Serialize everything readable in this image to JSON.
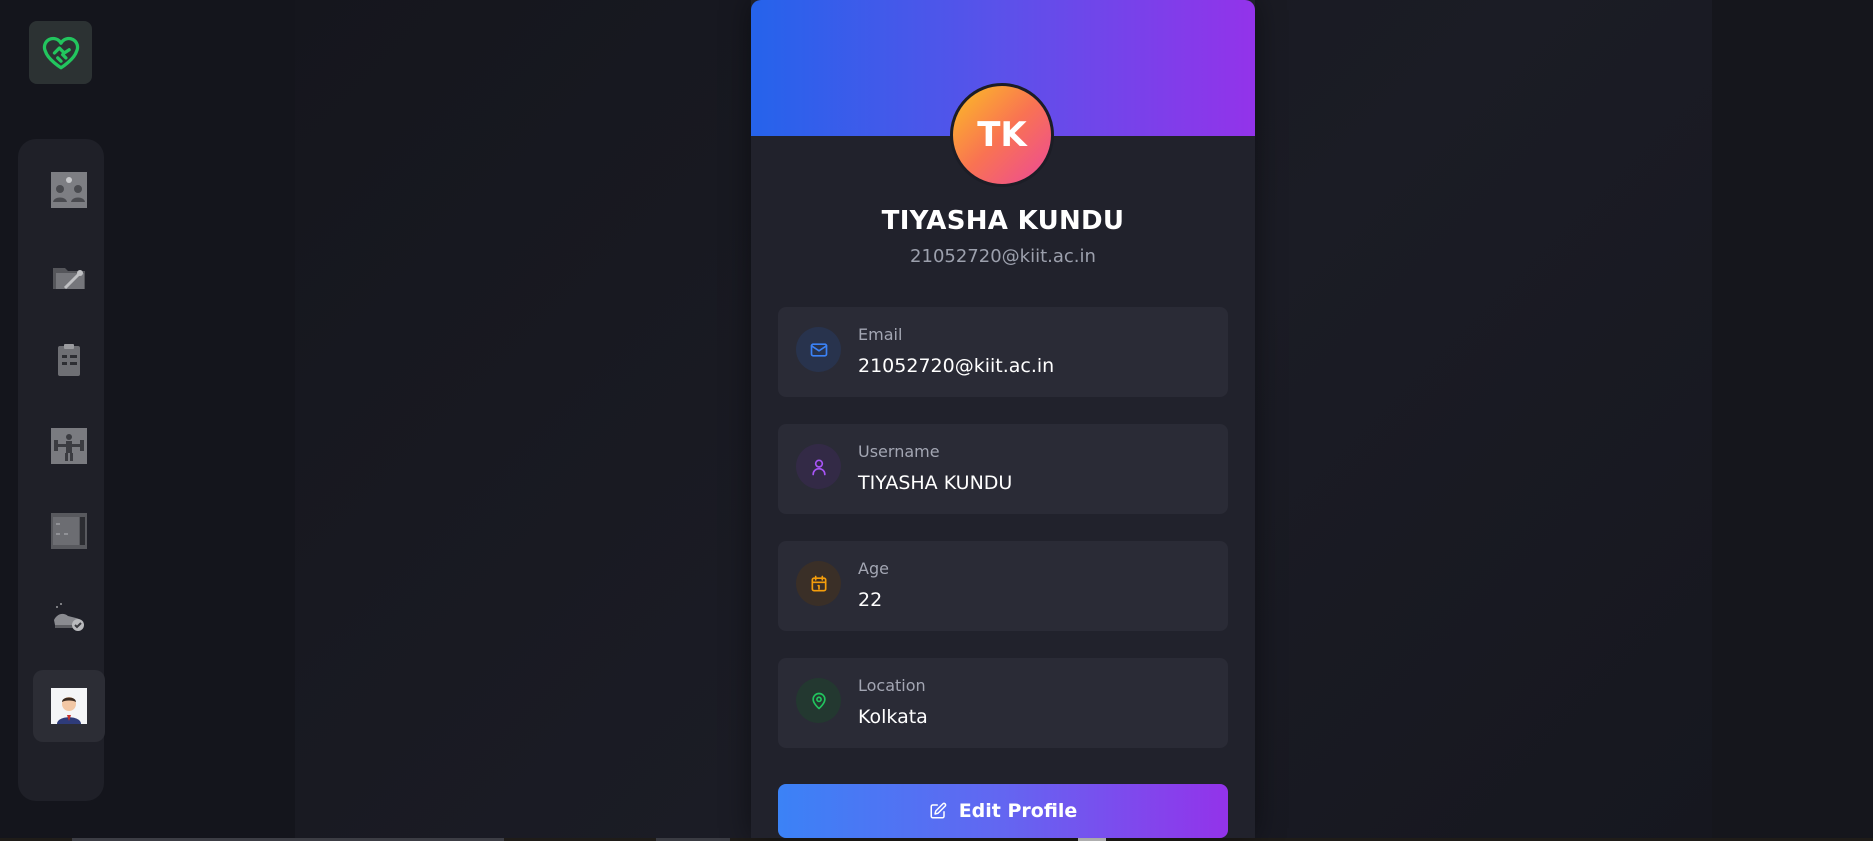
{
  "colors": {
    "header_gradient": [
      "#2563eb",
      "#9333ea"
    ],
    "avatar_gradient": [
      "#fbbf24",
      "#ec4899"
    ],
    "logo_green": "#22c55e",
    "email_accent": "#3b82f6",
    "username_accent": "#a855f7",
    "age_accent": "#f59e0b",
    "location_accent": "#22c55e"
  },
  "app": {
    "logo_icon": "heart-handshake-icon"
  },
  "sidebar": {
    "items": [
      {
        "icon": "group-meeting-icon",
        "active": false
      },
      {
        "icon": "folder-tools-icon",
        "active": false
      },
      {
        "icon": "clipboard-checklist-icon",
        "active": false
      },
      {
        "icon": "fitness-icon",
        "active": false
      },
      {
        "icon": "dashboard-panel-icon",
        "active": false
      },
      {
        "icon": "shoe-icon",
        "active": false
      },
      {
        "icon": "user-profile-icon",
        "active": true
      }
    ]
  },
  "profile": {
    "initials": "TK",
    "name": "TIYASHA KUNDU",
    "subtitle": "21052720@kiit.ac.in",
    "fields": [
      {
        "label": "Email",
        "value": "21052720@kiit.ac.in",
        "icon": "mail-icon"
      },
      {
        "label": "Username",
        "value": "TIYASHA KUNDU",
        "icon": "user-icon"
      },
      {
        "label": "Age",
        "value": "22",
        "icon": "calendar-icon"
      },
      {
        "label": "Location",
        "value": "Kolkata",
        "icon": "map-pin-icon"
      }
    ],
    "edit_label": "Edit Profile"
  }
}
